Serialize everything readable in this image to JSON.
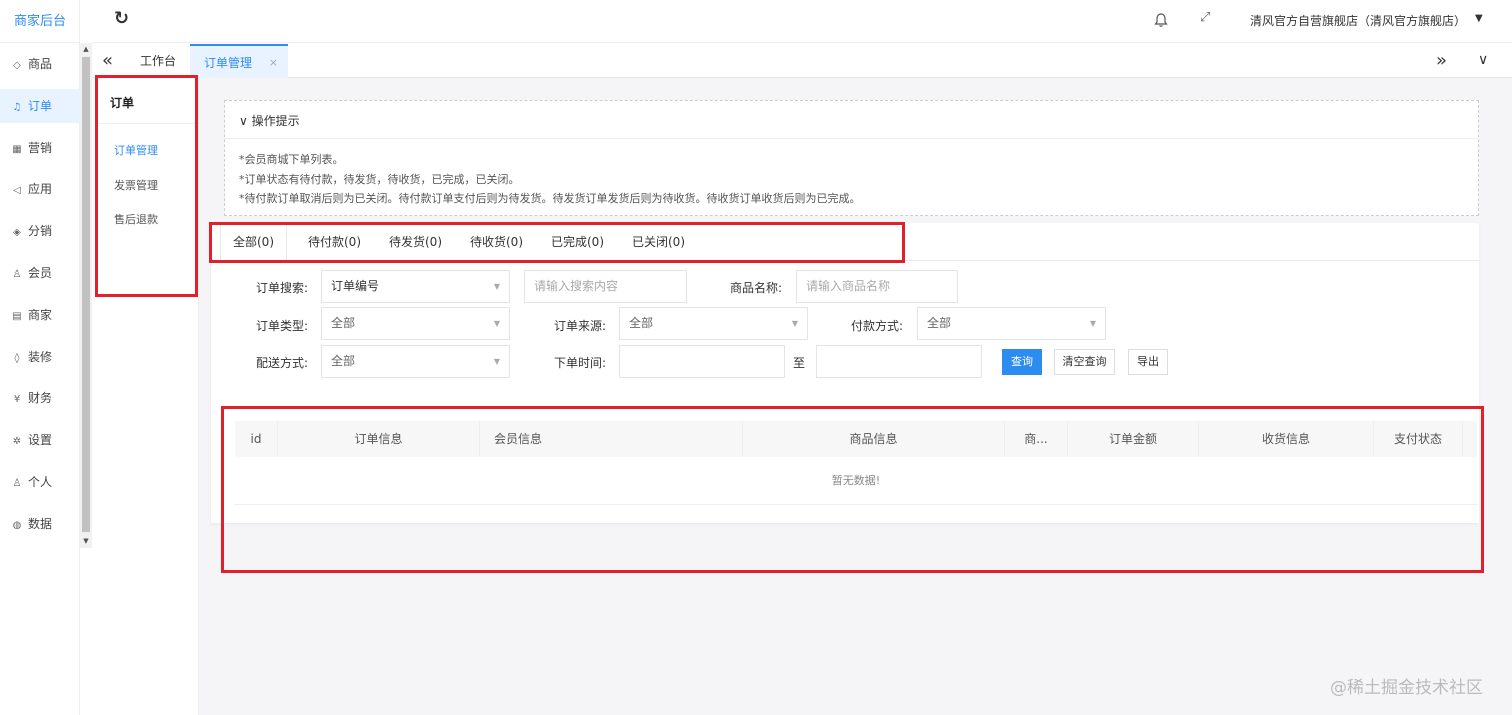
{
  "brand": "商家后台",
  "sidebar": {
    "items": [
      {
        "label": "商品",
        "icon": "gem-icon",
        "glyph": "◇"
      },
      {
        "label": "订单",
        "icon": "bell-icon",
        "glyph": "♫",
        "active": true
      },
      {
        "label": "营销",
        "icon": "grid-icon",
        "glyph": "▦"
      },
      {
        "label": "应用",
        "icon": "send-icon",
        "glyph": "◁"
      },
      {
        "label": "分销",
        "icon": "layers-icon",
        "glyph": "◈"
      },
      {
        "label": "会员",
        "icon": "user-icon",
        "glyph": "♙"
      },
      {
        "label": "商家",
        "icon": "store-icon",
        "glyph": "▤"
      },
      {
        "label": "装修",
        "icon": "tag-icon",
        "glyph": "◊"
      },
      {
        "label": "财务",
        "icon": "yen-icon",
        "glyph": "¥"
      },
      {
        "label": "设置",
        "icon": "gear-icon",
        "glyph": "✲"
      },
      {
        "label": "个人",
        "icon": "person-icon",
        "glyph": "♙"
      },
      {
        "label": "数据",
        "icon": "globe-icon",
        "glyph": "◍"
      }
    ]
  },
  "header": {
    "refresh_icon": "↻",
    "shop_name": "清风官方自营旗舰店（清风官方旗舰店）",
    "caret": "▼",
    "fullscreen_icon": "⤢"
  },
  "tabs": {
    "prev": "«",
    "next": "»",
    "menu": "∨",
    "home": "工作台",
    "current": "订单管理",
    "close": "×"
  },
  "submenu": {
    "title": "订单",
    "items": [
      "订单管理",
      "发票管理",
      "售后退款"
    ]
  },
  "tips": {
    "toggle": "∨",
    "title": "操作提示",
    "lines": [
      "*会员商城下单列表。",
      "*订单状态有待付款，待发货，待收货，已完成，已关闭。",
      "*待付款订单取消后则为已关闭。待付款订单支付后则为待发货。待发货订单发货后则为待收货。待收货订单收货后则为已完成。"
    ]
  },
  "status_tabs": [
    "全部(0)",
    "待付款(0)",
    "待发货(0)",
    "待收货(0)",
    "已完成(0)",
    "已关闭(0)"
  ],
  "filters": {
    "search_label": "订单搜索:",
    "search_type": "订单编号",
    "search_placeholder": "请输入搜索内容",
    "goods_label": "商品名称:",
    "goods_placeholder": "请输入商品名称",
    "type_label": "订单类型:",
    "type_value": "全部",
    "source_label": "订单来源:",
    "source_value": "全部",
    "pay_label": "付款方式:",
    "pay_value": "全部",
    "delivery_label": "配送方式:",
    "delivery_value": "全部",
    "time_label": "下单时间:",
    "time_to": "至",
    "query_btn": "查询",
    "clear_btn": "清空查询",
    "export_btn": "导出"
  },
  "table": {
    "columns": [
      "id",
      "订单信息",
      "会员信息",
      "商品信息",
      "商...",
      "订单金额",
      "收货信息",
      "支付状态"
    ],
    "empty": "暂无数据!"
  },
  "watermark": "@稀土掘金技术社区"
}
